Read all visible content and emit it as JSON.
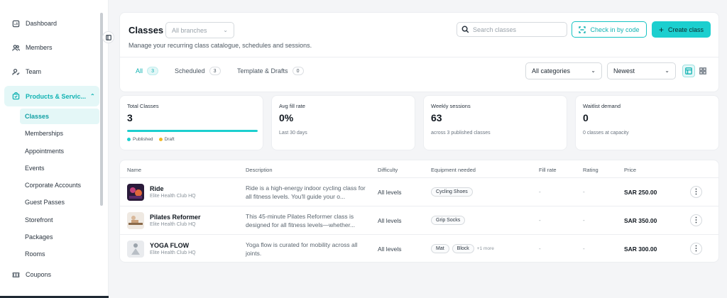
{
  "sidebar": {
    "items": [
      {
        "label": "Dashboard",
        "icon": "dashboard-icon"
      },
      {
        "label": "Members",
        "icon": "members-icon"
      },
      {
        "label": "Team",
        "icon": "team-icon"
      },
      {
        "label": "Products & Servic...",
        "icon": "bag-icon"
      },
      {
        "label": "Coupons",
        "icon": "ticket-icon"
      }
    ],
    "sub_items": [
      "Classes",
      "Memberships",
      "Appointments",
      "Events",
      "Corporate Accounts",
      "Guest Passes",
      "Storefront",
      "Packages",
      "Rooms"
    ]
  },
  "header": {
    "title": "Classes",
    "branch_placeholder": "All branches",
    "subtitle": "Manage your recurring class catalogue, schedules and sessions.",
    "search_placeholder": "Search classes",
    "checkin_label": "Check in by code",
    "create_label": "Create class"
  },
  "tabs": [
    {
      "label": "All",
      "count": "3"
    },
    {
      "label": "Scheduled",
      "count": "3"
    },
    {
      "label": "Template & Drafts",
      "count": "0"
    }
  ],
  "filters": {
    "category": "All categories",
    "sort": "Newest"
  },
  "stats": [
    {
      "label": "Total Classes",
      "value": "3",
      "progress": 1.0,
      "legend": [
        "Published",
        "Draft"
      ]
    },
    {
      "label": "Avg fill rate",
      "value": "0%",
      "note": "Last 30 days"
    },
    {
      "label": "Weekly sessions",
      "value": "63",
      "note": "across 3 published classes"
    },
    {
      "label": "Waitlist demand",
      "value": "0",
      "note": "0 classes at capacity"
    }
  ],
  "table": {
    "columns": [
      "Name",
      "Description",
      "Difficulty",
      "Equipment needed",
      "Fill rate",
      "Rating",
      "Price"
    ],
    "rows": [
      {
        "name": "Ride",
        "branch": "Elite Health Club HQ",
        "description": "Ride is a high-energy indoor cycling class for all fitness levels. You'll guide your o...",
        "difficulty": "All levels",
        "equipment": [
          "Cycling Shoes"
        ],
        "more": "",
        "fill_rate": "-",
        "rating": "-",
        "price": "SAR 250.00"
      },
      {
        "name": "Pilates Reformer",
        "branch": "Elite Health Club HQ",
        "description": "This 45-minute Pilates Reformer class is designed for all fitness levels—whether...",
        "difficulty": "All levels",
        "equipment": [
          "Grip Socks"
        ],
        "more": "",
        "fill_rate": "-",
        "rating": "-",
        "price": "SAR 350.00"
      },
      {
        "name": "YOGA FLOW",
        "branch": "Elite Health Club HQ",
        "description": "Yoga flow is curated for mobility across all joints.",
        "difficulty": "All levels",
        "equipment": [
          "Mat",
          "Block"
        ],
        "more": "+1 more",
        "fill_rate": "-",
        "rating": "-",
        "price": "SAR 300.00"
      }
    ]
  },
  "colors": {
    "accent": "#1ccfcf",
    "accent_text": "#11b3b3",
    "draft": "#f2b824"
  }
}
